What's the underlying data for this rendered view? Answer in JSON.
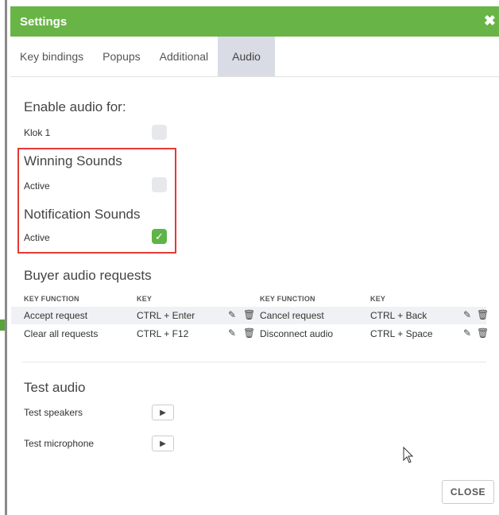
{
  "dialog": {
    "title": "Settings",
    "close_glyph": "✖"
  },
  "tabs": [
    {
      "label": "Key bindings",
      "active": false
    },
    {
      "label": "Popups",
      "active": false
    },
    {
      "label": "Additional",
      "active": false
    },
    {
      "label": "Audio",
      "active": true
    }
  ],
  "enable_audio": {
    "title": "Enable audio for:",
    "items": [
      {
        "label": "Klok 1",
        "checked": false
      }
    ]
  },
  "winning_sounds": {
    "title": "Winning Sounds",
    "active_label": "Active",
    "checked": false
  },
  "notification_sounds": {
    "title": "Notification Sounds",
    "active_label": "Active",
    "checked": true,
    "check_glyph": "✓"
  },
  "buyer_audio": {
    "title": "Buyer audio requests",
    "headers": [
      "KEY FUNCTION",
      "KEY",
      "KEY FUNCTION",
      "KEY"
    ],
    "rows": [
      {
        "func1": "Accept request",
        "key1": "CTRL + Enter",
        "func2": "Cancel request",
        "key2": "CTRL + Back"
      },
      {
        "func1": "Clear all requests",
        "key1": "CTRL + F12",
        "func2": "Disconnect audio",
        "key2": "CTRL + Space"
      }
    ],
    "edit_glyph": "✎",
    "delete_glyph": "🗑"
  },
  "test_audio": {
    "title": "Test audio",
    "speakers_label": "Test speakers",
    "microphone_label": "Test microphone",
    "play_glyph": "▶"
  },
  "footer": {
    "close_label": "CLOSE"
  },
  "colors": {
    "header": "#69b447",
    "checked": "#5fb447",
    "highlight": "#e53935",
    "active_tab": "#d9dce5"
  }
}
